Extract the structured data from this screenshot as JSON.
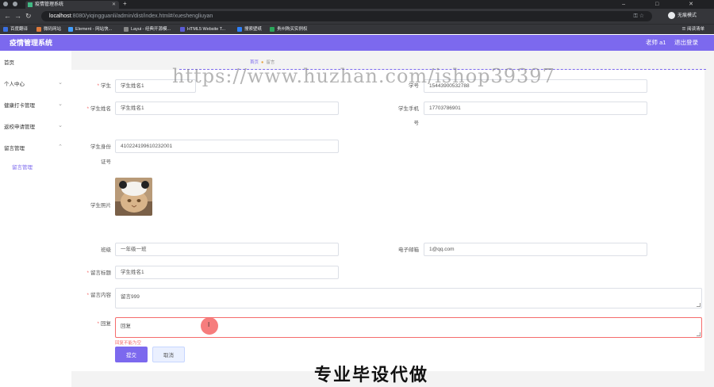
{
  "browser": {
    "tab_title": "疫情管理系统",
    "url_host": "localhost",
    "url_path": ":8080/yiqingguanli/admin/dist/index.html#/xueshengliuyan",
    "profile_label": "无痕模式",
    "bookmarks": [
      "百度翻译",
      "微码网站",
      "Element - 网站快...",
      "Layui - 经典开源模...",
      "HTML5 Website T...",
      "搜索壁纸",
      "贵州购买实例权"
    ],
    "bookmarks_right": "阅读清单",
    "window_controls": "– □ ✕"
  },
  "header": {
    "title": "疫情管理系统",
    "user": "老师 a1",
    "logout": "退出登录"
  },
  "sidebar": {
    "items": [
      {
        "label": "首页",
        "has_arrow": false
      },
      {
        "label": "个人中心",
        "has_arrow": true
      },
      {
        "label": "健康打卡管理",
        "has_arrow": true
      },
      {
        "label": "返校申请管理",
        "has_arrow": true
      },
      {
        "label": "留言管理",
        "has_arrow": true
      }
    ],
    "sub_item": "留言管理"
  },
  "breadcrumb": {
    "home": "首页",
    "current": "留言"
  },
  "form": {
    "student_label": "学生",
    "student_value": "学生姓名1",
    "student_no_label": "学号",
    "student_no_value": "15443900532788",
    "name_label": "学生姓名",
    "name_value": "学生姓名1",
    "phone_label_1": "学生手机",
    "phone_label_2": "号",
    "phone_value": "17703786901",
    "id_label_1": "学生身份",
    "id_label_2": "证号",
    "id_value": "410224199610232001",
    "photo_label": "学生照片",
    "class_label": "班级",
    "class_value": "一年级一班",
    "email_label": "电子邮箱",
    "email_value": "1@qq.com",
    "title_label": "留言标题",
    "title_value": "学生姓名1",
    "content_label": "留言内容",
    "content_value": "留言999",
    "reply_label": "回复",
    "reply_value": "回复",
    "reply_error": "回复不能为空",
    "submit": "提交",
    "cancel": "取消"
  },
  "overlay": {
    "watermark": "https://www.huzhan.com/ishop39397",
    "promo": "专业毕设代做",
    "cursor_glyph": "I"
  },
  "colors": {
    "accent": "#7c69ee",
    "error": "#f56c6c",
    "browser_dark": "#202124"
  }
}
